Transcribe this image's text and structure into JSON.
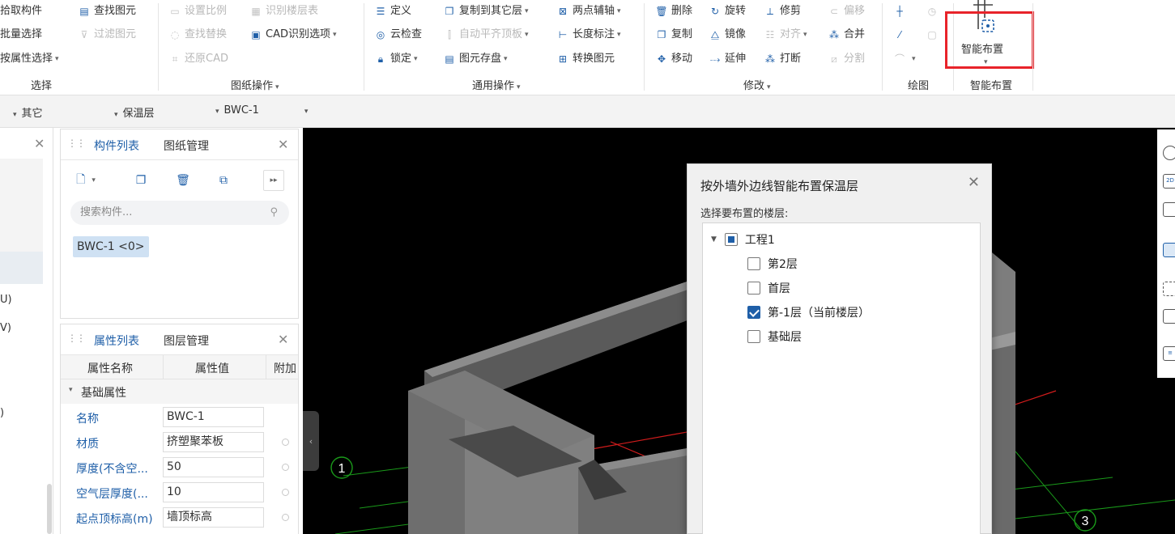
{
  "ribbon": {
    "select": {
      "label": "选择",
      "items": [
        "拾取构件",
        "批量选择",
        "按属性选择"
      ],
      "find": "查找图元",
      "filter": "过滤图元"
    },
    "drawing": {
      "label": "图纸操作",
      "items": [
        "设置比例",
        "识别楼层表",
        "查找替换",
        "CAD识别选项",
        "还原CAD"
      ]
    },
    "general": {
      "label": "通用操作",
      "items": [
        "定义",
        "复制到其它层",
        "两点辅轴",
        "云检查",
        "自动平齐顶板",
        "长度标注",
        "锁定",
        "图元存盘",
        "转换图元"
      ]
    },
    "modify": {
      "label": "修改",
      "items": [
        "删除",
        "旋转",
        "修剪",
        "偏移",
        "复制",
        "镜像",
        "对齐",
        "合并",
        "移动",
        "延伸",
        "打断",
        "分割"
      ]
    },
    "draw": {
      "label": "绘图"
    },
    "smart": {
      "button": "智能布置",
      "label": "智能布置"
    }
  },
  "filters": {
    "category": "其它",
    "type": "保温层",
    "component": "BWC-1"
  },
  "left_stub": {
    "rows": [
      "U)",
      "V)",
      ")"
    ]
  },
  "component_panel": {
    "tabs": [
      "构件列表",
      "图纸管理"
    ],
    "search_placeholder": "搜索构件...",
    "selected_component": "BWC-1 <0>"
  },
  "property_panel": {
    "tabs": [
      "属性列表",
      "图层管理"
    ],
    "columns": [
      "属性名称",
      "属性值",
      "附加"
    ],
    "group": "基础属性",
    "rows": [
      {
        "name": "名称",
        "value": "BWC-1"
      },
      {
        "name": "材质",
        "value": "挤塑聚苯板"
      },
      {
        "name": "厚度(不含空...",
        "value": "50"
      },
      {
        "name": "空气层厚度(...",
        "value": "10"
      },
      {
        "name": "起点顶标高(m)",
        "value": "墙顶标高"
      }
    ]
  },
  "viewport": {
    "axis_labels": [
      "1",
      "3"
    ]
  },
  "dialog": {
    "title": "按外墙外边线智能布置保温层",
    "subtitle": "选择要布置的楼层:",
    "root": "工程1",
    "floors": [
      {
        "label": "第2层",
        "checked": false
      },
      {
        "label": "首层",
        "checked": false
      },
      {
        "label": "第-1层（当前楼层）",
        "checked": true
      },
      {
        "label": "基础层",
        "checked": false
      }
    ]
  },
  "colors": {
    "accent": "#1f5fa8",
    "highlight_box": "#e8232a",
    "viewport_bg": "#000000"
  }
}
